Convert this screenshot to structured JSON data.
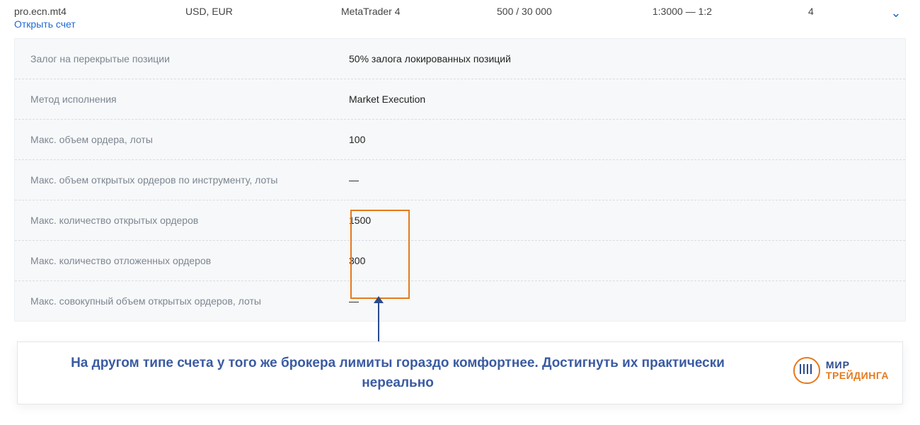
{
  "top": {
    "account_name": "pro.ecn.mt4",
    "open_account": "Открыть счет",
    "currency": "USD, EUR",
    "platform": "MetaTrader 4",
    "deposit": "500 / 30 000",
    "leverage": "1:3000 — 1:2",
    "digits": "4"
  },
  "rows": [
    {
      "label": "Залог на перекрытые позиции",
      "value": "50% залога локированных позиций"
    },
    {
      "label": "Метод исполнения",
      "value": "Market Execution"
    },
    {
      "label": "Макс. объем ордера, лоты",
      "value": "100"
    },
    {
      "label": "Макс. объем открытых ордеров по инструменту, лоты",
      "value": "—"
    },
    {
      "label": "Макс. количество открытых ордеров",
      "value": "1500"
    },
    {
      "label": "Макс. количество отложенных ордеров",
      "value": "300"
    },
    {
      "label": "Макс. совокупный объем открытых ордеров, лоты",
      "value": "—"
    }
  ],
  "caption": "На другом типе счета у того же брокера лимиты гораздо комфортнее. Достигнуть их практически нереально",
  "logo": {
    "line1": "МИР",
    "line2": "ТРЕЙДИНГА"
  }
}
